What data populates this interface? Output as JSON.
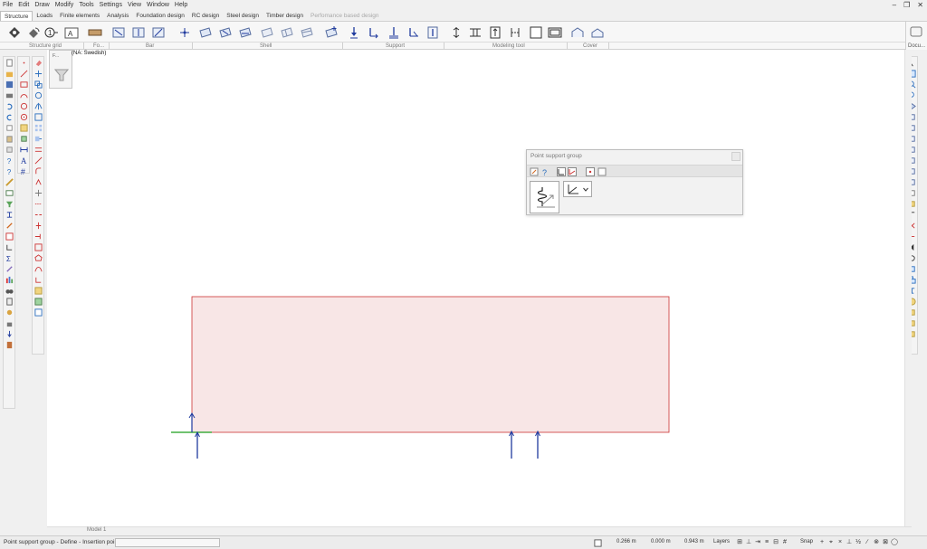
{
  "menu": [
    "File",
    "Edit",
    "Draw",
    "Modify",
    "Tools",
    "Settings",
    "View",
    "Window",
    "Help"
  ],
  "window_controls": [
    "–",
    "❐",
    "✕"
  ],
  "tabs": [
    {
      "label": "Structure",
      "active": true
    },
    {
      "label": "Loads"
    },
    {
      "label": "Finite elements"
    },
    {
      "label": "Analysis"
    },
    {
      "label": "Foundation design"
    },
    {
      "label": "RC design"
    },
    {
      "label": "Steel design"
    },
    {
      "label": "Timber design"
    },
    {
      "label": "Perfomance based design",
      "disabled": true
    }
  ],
  "ribbon_groups": [
    "Structure grid",
    "Fo...",
    "Bar",
    "Shell",
    "Support",
    "Modeling tool",
    "Cover"
  ],
  "doc_panel_label": "Docu...",
  "filter_tag": "F...",
  "na_label": "(NA: Swedish)",
  "float_window": {
    "title": "Point support group"
  },
  "model_tab": "Model 1",
  "status": {
    "prompt": "Point support group - Define - Insertion point :",
    "cmd_value": "",
    "coord_x": "0.266 m",
    "coord_y": "0.000 m",
    "coord_z": "0.943 m",
    "layers": "Layers",
    "snap": "Snap"
  },
  "colors": {
    "accent": "#1f3a9e",
    "shell_fill": "#f8e6e6",
    "shell_border": "#cc3333",
    "axis_green": "#1a9e1a"
  }
}
